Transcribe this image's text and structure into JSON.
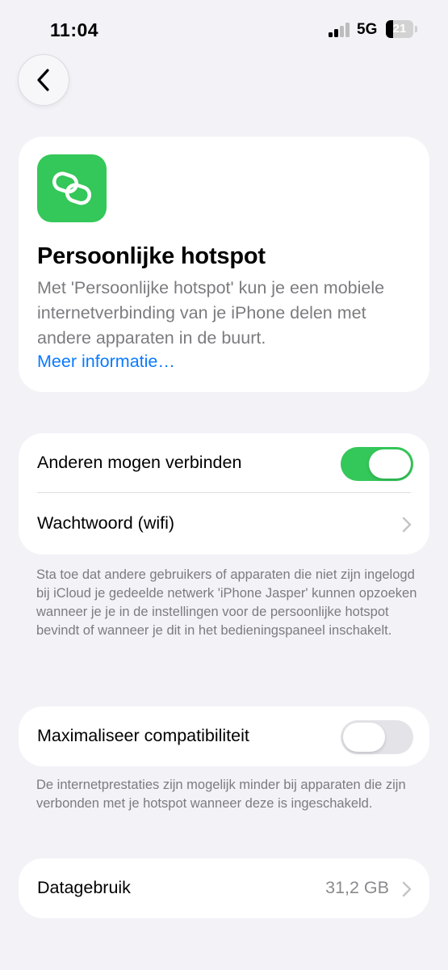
{
  "status_bar": {
    "time": "11:04",
    "network": "5G",
    "battery_level": "21",
    "icons": [
      "signal-icon",
      "battery-icon"
    ]
  },
  "nav": {
    "back_icon": "chevron-left-icon"
  },
  "info": {
    "icon": "link-chain-icon",
    "icon_color": "#34c759",
    "title": "Persoonlijke hotspot",
    "description": "Met 'Persoonlijke hotspot' kun je een mobiele internetverbinding van je iPhone delen met andere apparaten in de buurt.",
    "link": "Meer informatie…"
  },
  "settings": {
    "allow_others_label": "Anderen mogen verbinden",
    "allow_others_on": true,
    "password_label": "Wachtwoord (wifi)",
    "footnote": "Sta toe dat andere gebruikers of apparaten die niet zijn ingelogd bij iCloud je gedeelde netwerk 'iPhone Jasper' kunnen opzoeken wanneer je je in de instellingen voor de persoonlijke hotspot bevindt of wanneer je dit in het bedieningspaneel inschakelt."
  },
  "compatibility": {
    "label": "Maximaliseer compatibiliteit",
    "on": false,
    "footnote": "De internetprestaties zijn mogelijk minder bij apparaten die zijn verbonden met je hotspot wanneer deze is ingeschakeld."
  },
  "usage": {
    "label": "Datagebruik",
    "value": "31,2 GB"
  },
  "colors": {
    "accent_green": "#34c759",
    "link_blue": "#0a7aff",
    "background": "#f2f2f7"
  }
}
